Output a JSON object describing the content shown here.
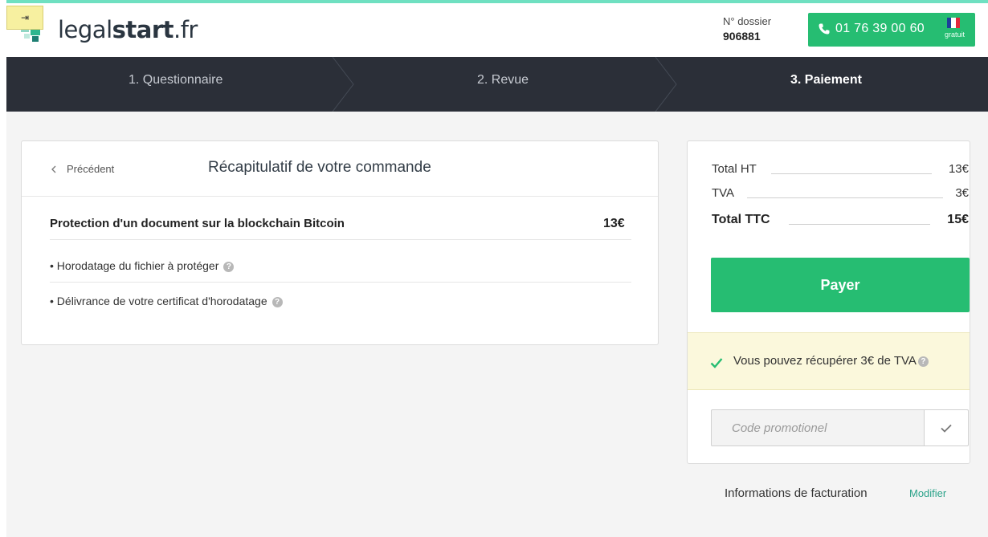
{
  "colors": {
    "accent": "#26bd72",
    "nav_bg": "#2b2f38",
    "link": "#2ca38a",
    "notice_bg": "#fbf8dc"
  },
  "sticky_tab": {
    "label": "⇥"
  },
  "header": {
    "logo_light": "legal",
    "logo_bold": "start",
    "logo_tld": ".fr",
    "dossier_label": "N° dossier",
    "dossier_number": "906881",
    "phone": "01 76 39 00 60",
    "phone_note": "gratuit",
    "phone_icon": "phone-icon",
    "flag_icon": "flag-france-icon"
  },
  "steps": [
    {
      "label": "1. Questionnaire",
      "active": false
    },
    {
      "label": "2. Revue",
      "active": false
    },
    {
      "label": "3. Paiement",
      "active": true
    }
  ],
  "order": {
    "back_label": "Précédent",
    "title": "Récapitulatif de votre commande",
    "product_name": "Protection d'un document sur la blockchain Bitcoin",
    "product_price": "13€",
    "features": [
      "• Horodatage du fichier à protéger",
      "• Délivrance de votre certificat d'horodatage"
    ],
    "help_glyph": "?"
  },
  "summary": {
    "total_ht_label": "Total HT",
    "total_ht": "13€",
    "tva_label": "TVA",
    "tva": "3€",
    "total_ttc_label": "Total TTC",
    "total_ttc": "15€",
    "pay_label": "Payer",
    "tva_notice": "Vous pouvez récupérer 3€ de TVA",
    "promo_placeholder": "Code promotionel"
  },
  "billing": {
    "label": "Informations de facturation",
    "modify_label": "Modifier"
  }
}
